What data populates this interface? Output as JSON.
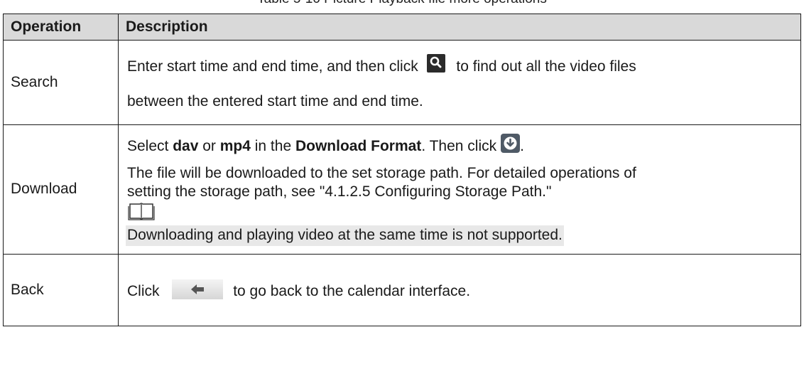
{
  "caption": "Table 5-10 Picture Playback file more operations",
  "table": {
    "headers": [
      "Operation",
      "Description"
    ],
    "search": {
      "operation": "Search",
      "line1_before_icon": "Enter start time and end time, and then click",
      "line1_after_icon": "to find out all the video files",
      "line2": "between the entered start time and end time.",
      "icon": "search-icon"
    },
    "download": {
      "operation": "Download",
      "p1_select": "Select ",
      "p1_dav": "dav",
      "p1_or": " or ",
      "p1_mp4": "mp4",
      "p1_in_the": " in the ",
      "p1_format": "Download Format",
      "p1_then_click": ". Then click",
      "p1_end": ".",
      "p2_line1": "The file will be downloaded to the set storage path. For detailed operations of",
      "p2_line2": "setting the storage path, see \"4.1.2.5 Configuring Storage Path.\"",
      "note_icon": "book-note-icon",
      "note_text": "Downloading and playing video at the same time is not supported.",
      "icon": "download-icon"
    },
    "back": {
      "operation": "Back",
      "before_icon": "Click",
      "after_icon": "to go back to the calendar interface.",
      "icon": "back-arrow-icon"
    }
  },
  "colors": {
    "header_bg": "#d9d9d9",
    "note_highlight": "#e8e8e8",
    "border": "#1a1a1a"
  }
}
